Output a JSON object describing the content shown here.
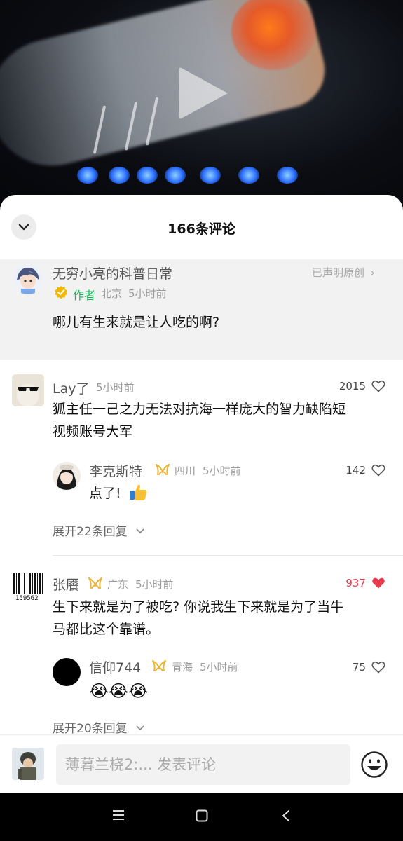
{
  "sheet": {
    "title": "166条评论"
  },
  "author_comment": {
    "username": "无穷小亮的科普日常",
    "badge": "作者",
    "location": "北京",
    "time": "5小时前",
    "original_label": "已声明原创",
    "text": "哪儿有生来就是让人吃的啊?"
  },
  "comments": [
    {
      "username": "Lay了",
      "time": "5小时前",
      "likes": "2015",
      "liked": false,
      "text_line1": "狐主任一己之力无法对抗海一样庞大的智力缺陷短",
      "text_line2": "视频账号大军",
      "reply": {
        "username": "李克斯特",
        "location": "四川",
        "time": "5小时前",
        "likes": "142",
        "text": "点了!"
      },
      "expand_label": "展开22条回复"
    },
    {
      "username": "张餍",
      "location": "广东",
      "time": "5小时前",
      "likes": "937",
      "liked": true,
      "avatar_text": "159562",
      "text_line1": "生下来就是为了被吃? 你说我生下来就是为了当牛",
      "text_line2": "马都比这个靠谱。",
      "reply": {
        "username": "信仰744",
        "location": "青海",
        "time": "5小时前",
        "likes": "75",
        "text": "😭😭😭"
      },
      "expand_label": "展开20条回复"
    }
  ],
  "input": {
    "placeholder": "薄暮兰桡2:... 发表评论"
  },
  "colors": {
    "liked_red": "#e8394d",
    "verified_gold": "#f2b705",
    "author_green": "#19b35a"
  }
}
